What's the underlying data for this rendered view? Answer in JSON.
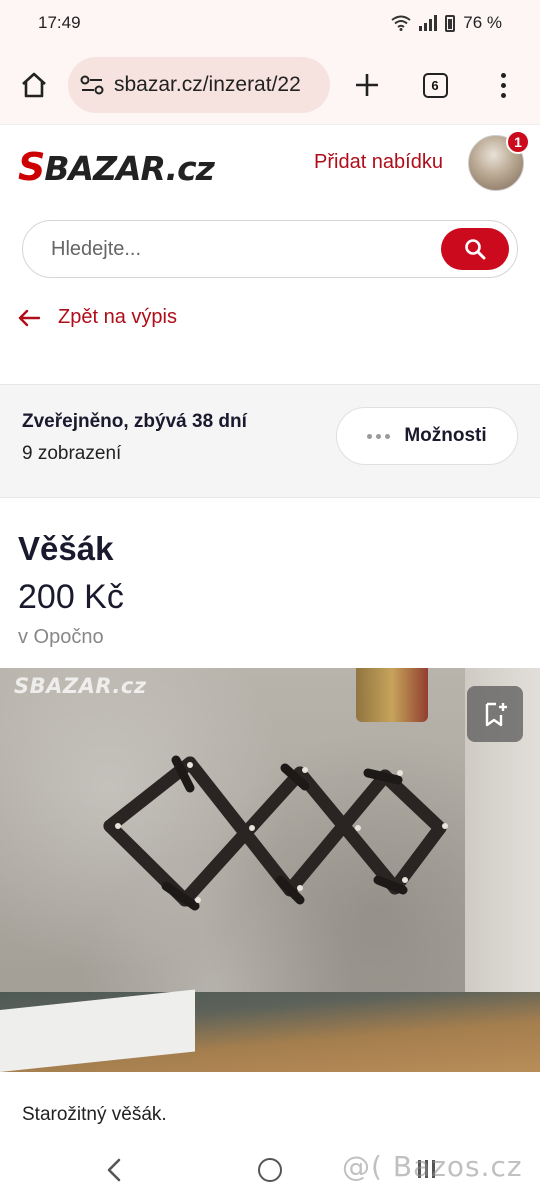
{
  "status_bar": {
    "time": "17:49",
    "battery": "76 %"
  },
  "browser": {
    "url": "sbazar.cz/inzerat/22",
    "tab_count": "6"
  },
  "header": {
    "logo": "SBAZAR.cz",
    "add_offer_label": "Přidat nabídku",
    "notification_count": "1"
  },
  "search": {
    "placeholder": "Hledejte..."
  },
  "back_link": "Zpět na výpis",
  "listing_info": {
    "published": "Zveřejněno, zbývá 38 dní",
    "views": "9 zobrazení",
    "options_label": "Možnosti"
  },
  "listing": {
    "title": "Věšák",
    "price": "200 Kč",
    "location": "v Opočno",
    "photo_watermark": "SBAZAR.cz",
    "description": "Starožitný věšák."
  },
  "overlay_watermark": "@( Bazos.cz"
}
